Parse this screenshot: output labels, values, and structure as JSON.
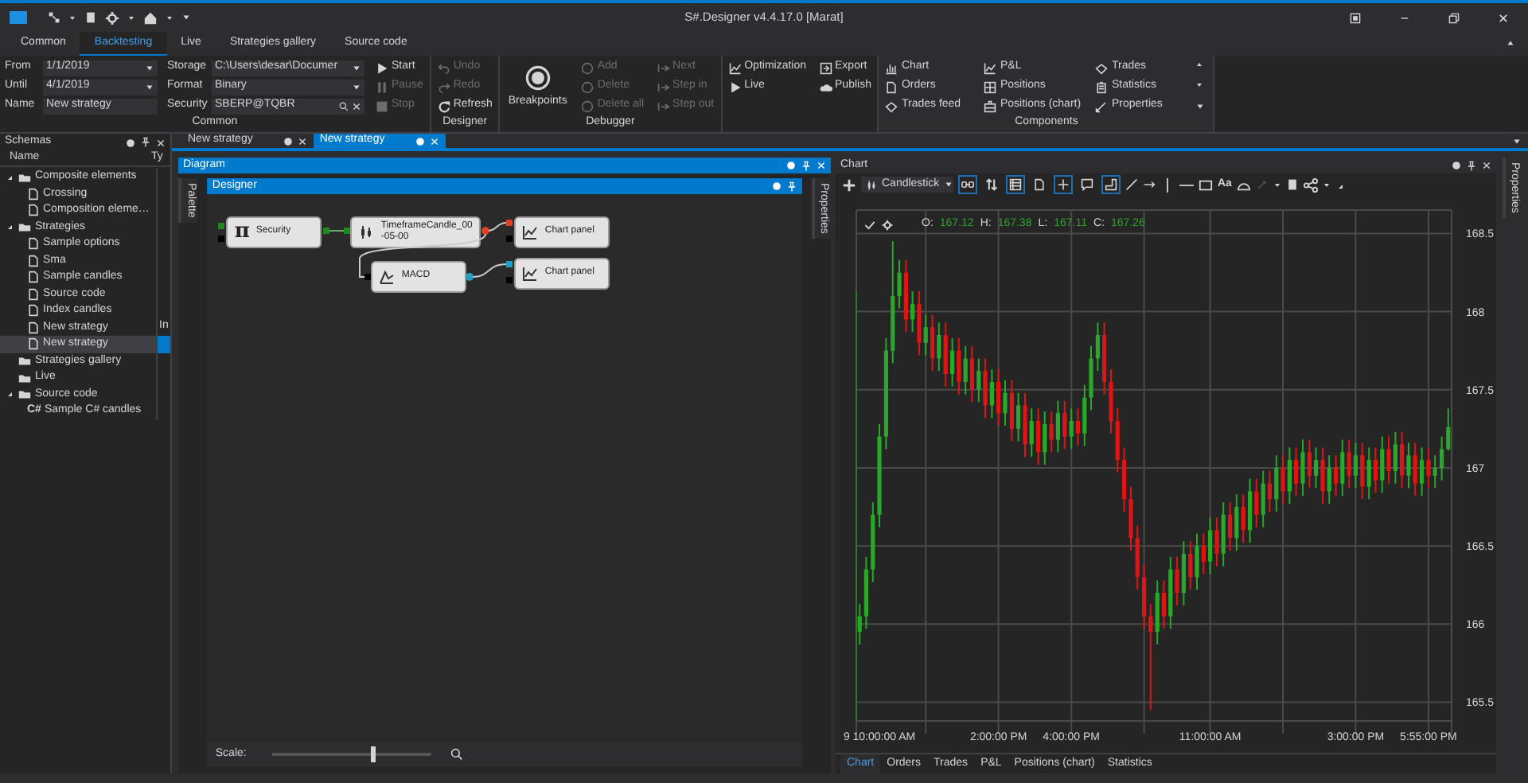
{
  "window": {
    "title": "S#.Designer v4.4.17.0 [Marat]"
  },
  "ribbon_tabs": [
    {
      "label": "Common",
      "selected": false
    },
    {
      "label": "Backtesting",
      "selected": true
    },
    {
      "label": "Live",
      "selected": false
    },
    {
      "label": "Strategies gallery",
      "selected": false
    },
    {
      "label": "Source code",
      "selected": false
    }
  ],
  "ribbon_groups": [
    {
      "kind": "settings",
      "caption": "Common",
      "field_columns": [
        [
          {
            "label": "From",
            "value": "1/1/2019",
            "kind": "dropdown"
          },
          {
            "label": "Until",
            "value": "4/1/2019",
            "kind": "dropdown"
          },
          {
            "label": "Name",
            "value": "New strategy",
            "kind": "text"
          }
        ],
        [
          {
            "label": "Storage",
            "value": "C:\\Users\\desar\\Documer",
            "kind": "dropdown"
          },
          {
            "label": "Format",
            "value": "Binary",
            "kind": "dropdown"
          },
          {
            "label": "Security",
            "value": "SBERP@TQBR",
            "kind": "search"
          }
        ]
      ],
      "columns": [
        [
          {
            "label": "Start",
            "disabled": false
          },
          {
            "label": "Pause",
            "disabled": true
          },
          {
            "label": "Stop",
            "disabled": true
          }
        ]
      ]
    },
    {
      "kind": "buttons",
      "caption": "Designer",
      "columns": [
        [
          {
            "label": "Undo",
            "disabled": true
          },
          {
            "label": "Redo",
            "disabled": true
          },
          {
            "label": "Refresh",
            "disabled": false
          }
        ]
      ]
    },
    {
      "kind": "debugger",
      "caption": "Debugger",
      "large_button": {
        "label": "Breakpoints",
        "disabled": false
      },
      "columns": [
        [
          {
            "label": "Add",
            "disabled": true
          },
          {
            "label": "Delete",
            "disabled": true
          },
          {
            "label": "Delete all",
            "disabled": true
          }
        ],
        [
          {
            "label": "Next",
            "disabled": true
          },
          {
            "label": "Step in",
            "disabled": true
          },
          {
            "label": "Step out",
            "disabled": true
          }
        ]
      ]
    },
    {
      "kind": "buttons",
      "columns": [
        [
          {
            "label": "Optimization",
            "disabled": false
          },
          {
            "label": "Live",
            "disabled": false
          }
        ],
        [
          {
            "label": "Export",
            "disabled": false
          },
          {
            "label": "Publish",
            "disabled": false
          }
        ]
      ]
    },
    {
      "kind": "gallery",
      "caption": "Components",
      "columns": [
        [
          {
            "label": "Chart",
            "disabled": false
          },
          {
            "label": "Orders",
            "disabled": false
          },
          {
            "label": "Trades feed",
            "disabled": false
          }
        ],
        [
          {
            "label": "P&L",
            "disabled": false
          },
          {
            "label": "Positions",
            "disabled": false
          },
          {
            "label": "Positions (chart)",
            "disabled": false
          }
        ],
        [
          {
            "label": "Trades",
            "disabled": false
          },
          {
            "label": "Statistics",
            "disabled": false
          },
          {
            "label": "Properties",
            "disabled": false
          }
        ]
      ]
    }
  ],
  "schemas": {
    "title": "Schemas",
    "columns": [
      "Name",
      "Ty"
    ],
    "tree": [
      {
        "label": "Composite elements",
        "expanded": true,
        "selected": false,
        "children": [
          {
            "label": "Crossing",
            "selected": false
          },
          {
            "label": "Composition eleme…",
            "selected": false
          }
        ]
      },
      {
        "label": "Strategies",
        "expanded": true,
        "selected": false,
        "children": [
          {
            "label": "Sample options",
            "selected": false
          },
          {
            "label": "Sma",
            "selected": false
          },
          {
            "label": "Sample candles",
            "selected": false
          },
          {
            "label": "Source code",
            "selected": false
          },
          {
            "label": "Index candles",
            "selected": false
          },
          {
            "label": "New strategy",
            "type": "In",
            "selected": false
          },
          {
            "label": "New strategy",
            "selected": true
          }
        ]
      },
      {
        "label": "Strategies gallery",
        "selected": false
      },
      {
        "label": "Live",
        "selected": false
      },
      {
        "label": "Source code",
        "expanded": true,
        "selected": false,
        "children": [
          {
            "label": "Sample C# candles",
            "badge": "C#",
            "selected": false
          }
        ]
      }
    ]
  },
  "document_tabs": [
    {
      "label": "New strategy",
      "selected": false
    },
    {
      "label": "New strategy",
      "selected": true
    }
  ],
  "diagram": {
    "title": "Diagram",
    "side_tabs": [
      "Palette",
      "Properties"
    ],
    "designer": {
      "title": "Designer",
      "nodes": [
        {
          "label": "Security",
          "icon_text": "π"
        },
        {
          "label": "TimeframeCandle_00-05-00"
        },
        {
          "label": "Chart panel"
        },
        {
          "label": "MACD"
        },
        {
          "label": "Chart panel"
        }
      ],
      "scale": {
        "label": "Scale:",
        "level": 0.62
      }
    }
  },
  "chart_panel": {
    "title": "Chart",
    "side_tab": "Properties",
    "chart_type": "Candlestick",
    "toggles": [
      {
        "selected": true
      },
      {
        "selected": false
      },
      {
        "selected": true
      },
      {
        "selected": false
      },
      {
        "selected": true
      },
      {
        "selected": false
      },
      {
        "selected": true
      }
    ],
    "text_tool": "Aa",
    "legend": [
      {
        "label": "O:",
        "value": "167.12"
      },
      {
        "label": "H:",
        "value": "167.38"
      },
      {
        "label": "L:",
        "value": "167.11"
      },
      {
        "label": "C:",
        "value": "167.26"
      }
    ],
    "chart_data": {
      "type": "candlestick",
      "categories": [
        null,
        null,
        null,
        "9 10:00:00 AM",
        null,
        null,
        null,
        null,
        null,
        null,
        null,
        null,
        null,
        null,
        null,
        null,
        null,
        null,
        null,
        null,
        null,
        "2:00:00 PM",
        null,
        null,
        null,
        null,
        null,
        null,
        null,
        null,
        null,
        null,
        "4:00:00 PM",
        null,
        null,
        null,
        null,
        null,
        null,
        null,
        null,
        null,
        null,
        null,
        null,
        null,
        null,
        null,
        null,
        null,
        null,
        null,
        null,
        "11:00:00 AM",
        null,
        null,
        null,
        null,
        null,
        null,
        null,
        null,
        null,
        null,
        null,
        null,
        null,
        null,
        null,
        null,
        null,
        null,
        null,
        null,
        null,
        "3:00:00 PM",
        null,
        null,
        null,
        null,
        null,
        null,
        null,
        null,
        null,
        null,
        "5:55:00 PM",
        null,
        null,
        null
      ],
      "ohlc": [
        [
          165.95,
          166.13,
          165.87,
          166.05
        ],
        [
          166.05,
          166.43,
          165.97,
          166.35
        ],
        [
          166.35,
          166.78,
          166.27,
          166.7
        ],
        [
          166.7,
          167.28,
          166.62,
          167.2
        ],
        [
          167.2,
          167.83,
          167.12,
          167.75
        ],
        [
          167.75,
          168.45,
          167.67,
          168.1
        ],
        [
          168.1,
          168.33,
          168.02,
          168.25
        ],
        [
          168.25,
          168.33,
          167.87,
          167.95
        ],
        [
          167.95,
          168.13,
          167.87,
          168.05
        ],
        [
          168.05,
          168.13,
          167.72,
          167.8
        ],
        [
          167.8,
          167.98,
          167.72,
          167.9
        ],
        [
          167.9,
          167.98,
          167.62,
          167.7
        ],
        [
          167.7,
          167.93,
          167.62,
          167.85
        ],
        [
          167.85,
          167.93,
          167.52,
          167.6
        ],
        [
          167.6,
          167.83,
          167.52,
          167.75
        ],
        [
          167.75,
          167.83,
          167.47,
          167.55
        ],
        [
          167.55,
          167.78,
          167.47,
          167.7
        ],
        [
          167.7,
          167.78,
          167.42,
          167.5
        ],
        [
          167.5,
          167.7,
          167.42,
          167.62
        ],
        [
          167.62,
          167.7,
          167.32,
          167.4
        ],
        [
          167.4,
          167.63,
          167.32,
          167.55
        ],
        [
          167.55,
          167.63,
          167.27,
          167.35
        ],
        [
          167.35,
          167.56,
          167.27,
          167.48
        ],
        [
          167.48,
          167.56,
          167.17,
          167.25
        ],
        [
          167.25,
          167.48,
          167.17,
          167.4
        ],
        [
          167.4,
          167.48,
          167.07,
          167.15
        ],
        [
          167.15,
          167.38,
          167.07,
          167.3
        ],
        [
          167.3,
          167.38,
          167.02,
          167.1
        ],
        [
          167.1,
          167.36,
          167.02,
          167.28
        ],
        [
          167.28,
          167.36,
          167.1,
          167.18
        ],
        [
          167.18,
          167.43,
          167.1,
          167.35
        ],
        [
          167.35,
          167.43,
          167.12,
          167.2
        ],
        [
          167.2,
          167.38,
          167.12,
          167.3
        ],
        [
          167.3,
          167.38,
          167.14,
          167.22
        ],
        [
          167.22,
          167.53,
          167.14,
          167.45
        ],
        [
          167.45,
          167.78,
          167.37,
          167.7
        ],
        [
          167.7,
          167.93,
          167.62,
          167.85
        ],
        [
          167.85,
          167.93,
          167.47,
          167.55
        ],
        [
          167.55,
          167.63,
          167.22,
          167.3
        ],
        [
          167.3,
          167.38,
          166.97,
          167.05
        ],
        [
          167.05,
          167.13,
          166.72,
          166.8
        ],
        [
          166.8,
          166.88,
          166.47,
          166.55
        ],
        [
          166.55,
          166.63,
          166.22,
          166.3
        ],
        [
          166.3,
          166.38,
          165.97,
          166.05
        ],
        [
          166.05,
          166.13,
          165.45,
          165.95
        ],
        [
          165.95,
          166.28,
          165.87,
          166.2
        ],
        [
          166.2,
          166.28,
          165.97,
          166.05
        ],
        [
          166.05,
          166.43,
          165.97,
          166.35
        ],
        [
          166.35,
          166.43,
          166.12,
          166.2
        ],
        [
          166.2,
          166.53,
          166.12,
          166.45
        ],
        [
          166.45,
          166.53,
          166.22,
          166.3
        ],
        [
          166.3,
          166.58,
          166.22,
          166.5
        ],
        [
          166.5,
          166.58,
          166.32,
          166.4
        ],
        [
          166.4,
          166.68,
          166.32,
          166.6
        ],
        [
          166.6,
          166.68,
          166.37,
          166.45
        ],
        [
          166.45,
          166.78,
          166.37,
          166.7
        ],
        [
          166.7,
          166.78,
          166.47,
          166.55
        ],
        [
          166.55,
          166.83,
          166.47,
          166.75
        ],
        [
          166.75,
          166.83,
          166.52,
          166.6
        ],
        [
          166.6,
          166.93,
          166.52,
          166.85
        ],
        [
          166.85,
          166.93,
          166.62,
          166.7
        ],
        [
          166.7,
          166.98,
          166.62,
          166.9
        ],
        [
          166.9,
          166.98,
          166.72,
          166.8
        ],
        [
          166.8,
          167.08,
          166.72,
          167.0
        ],
        [
          167.0,
          167.08,
          166.77,
          166.85
        ],
        [
          166.85,
          167.13,
          166.77,
          167.05
        ],
        [
          167.05,
          167.13,
          166.82,
          166.9
        ],
        [
          166.9,
          167.18,
          166.82,
          167.1
        ],
        [
          167.1,
          167.18,
          166.87,
          166.95
        ],
        [
          166.95,
          167.13,
          166.87,
          167.05
        ],
        [
          167.05,
          167.13,
          166.77,
          166.85
        ],
        [
          166.85,
          167.08,
          166.77,
          167.0
        ],
        [
          167.0,
          167.08,
          166.82,
          166.9
        ],
        [
          166.9,
          167.18,
          166.82,
          167.1
        ],
        [
          167.1,
          167.18,
          166.87,
          166.95
        ],
        [
          166.95,
          167.16,
          166.87,
          167.08
        ],
        [
          167.08,
          167.16,
          166.8,
          166.88
        ],
        [
          166.88,
          167.13,
          166.8,
          167.05
        ],
        [
          167.05,
          167.13,
          166.84,
          166.92
        ],
        [
          166.92,
          167.2,
          166.84,
          167.12
        ],
        [
          167.12,
          167.2,
          166.9,
          166.98
        ],
        [
          166.98,
          167.23,
          166.9,
          167.15
        ],
        [
          167.15,
          167.23,
          166.87,
          166.95
        ],
        [
          166.95,
          167.16,
          166.87,
          167.08
        ],
        [
          167.08,
          167.16,
          166.82,
          166.9
        ],
        [
          166.9,
          167.13,
          166.82,
          167.05
        ],
        [
          167.05,
          167.13,
          166.87,
          166.95
        ],
        [
          166.95,
          167.08,
          166.87,
          167.0
        ],
        [
          167.0,
          167.2,
          166.92,
          167.12
        ],
        [
          167.12,
          167.38,
          167.11,
          167.26
        ]
      ],
      "ylim": [
        165.38,
        168.65
      ],
      "grid": true,
      "yticks": [
        168.5,
        168,
        167.5,
        167,
        166.5,
        166,
        165.5
      ]
    },
    "tabs": [
      {
        "label": "Chart",
        "selected": true
      },
      {
        "label": "Orders",
        "selected": false
      },
      {
        "label": "Trades",
        "selected": false
      },
      {
        "label": "P&L",
        "selected": false
      },
      {
        "label": "Positions (chart)",
        "selected": false
      },
      {
        "label": "Statistics",
        "selected": false
      }
    ]
  }
}
